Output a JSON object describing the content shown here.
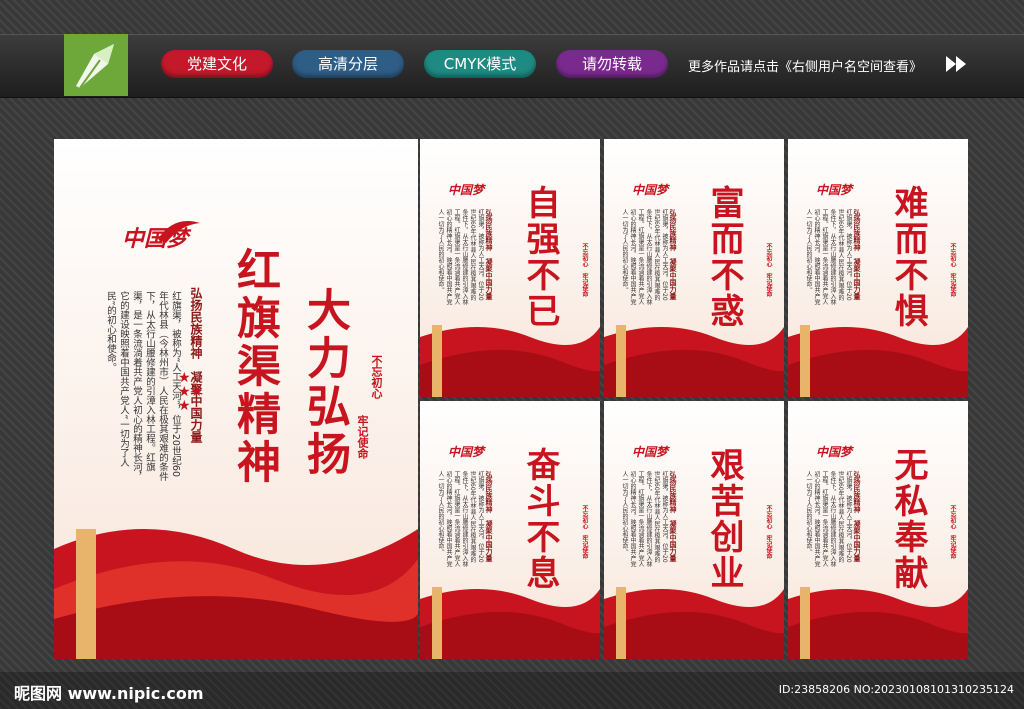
{
  "toolbar": {
    "tags": [
      "党建文化",
      "高清分层",
      "CMYK模式",
      "请勿转载"
    ],
    "notice": "更多作品请点击《右侧用户名空间查看》",
    "colors": {
      "red": "#c4192b",
      "blue": "#2e5d86",
      "teal": "#1e8a82",
      "purple": "#7a2a8f",
      "logo": "#6fa83a"
    }
  },
  "main_poster": {
    "logo_text": "中国梦",
    "heading_1": "红旗渠精神",
    "heading_2": "大力弘扬",
    "subtitle": "弘扬民族精神　凝聚中国力量",
    "stamp_1": "不忘初心",
    "stamp_2": "牢记使命",
    "body": "红旗渠，被称为“人工天河”，位于20世纪60年代林县（今林州市）人民在极其艰难的条件下，从太行山腰修建的引漳入林工程。红旗渠，是一条流淌着共产党人初心的精神长河，它的建设映照着中国共产党人“一切为了人民”的初心和使命。"
  },
  "small_posters": [
    {
      "title": "自强不已"
    },
    {
      "title": "富而不惑"
    },
    {
      "title": "难而不惧"
    },
    {
      "title": "奋斗不息"
    },
    {
      "title": "艰苦创业"
    },
    {
      "title": "无私奉献"
    }
  ],
  "small_common": {
    "logo_text": "中国梦",
    "subtitle": "弘扬民族精神　凝聚中国力量",
    "stamp": "不忘初心　牢记使命",
    "body": "红旗渠，被称为人工天河，位于20世纪60年代林县人民在极其艰难的条件下，从太行山腰修建的引漳入林工程。红旗渠是一条流淌着共产党人初心的精神长河，映照着中国共产党人一切为了人民的初心和使命。"
  },
  "footer": {
    "site": "昵图网 www.nipic.com",
    "id": "ID:23858206 NO:20230108101310235124"
  }
}
